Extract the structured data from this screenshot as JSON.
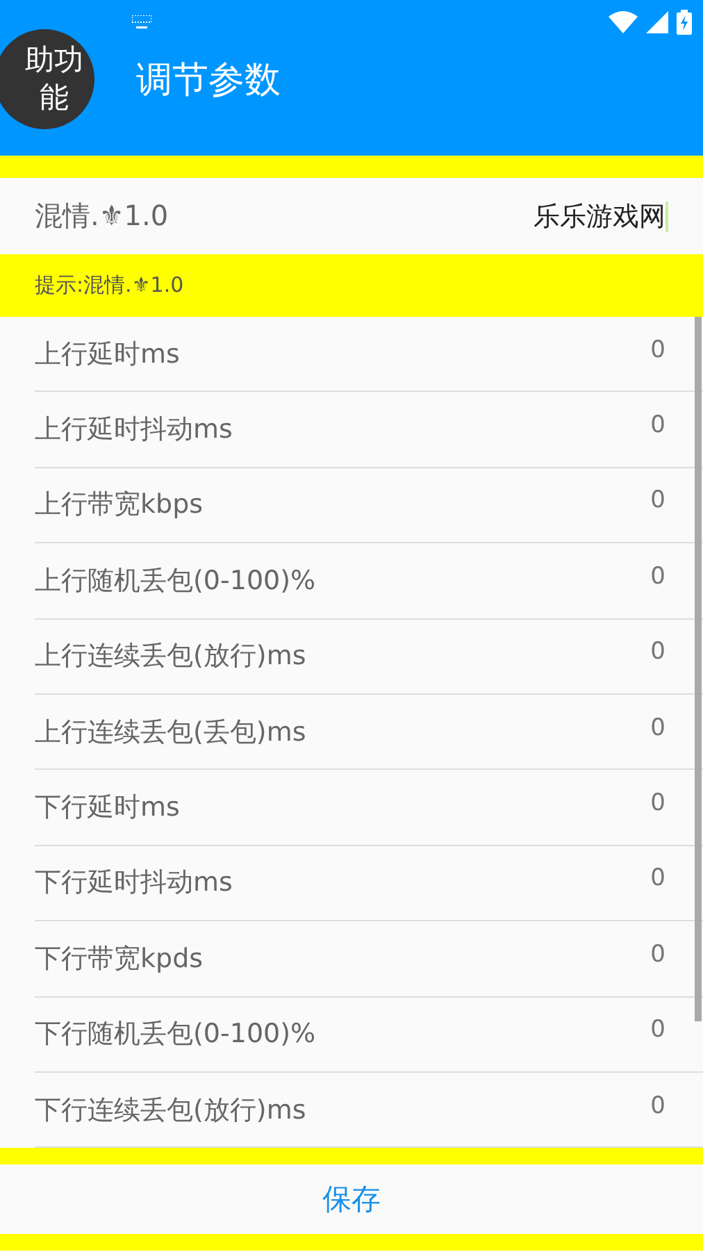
{
  "status_bar": {
    "keyboard_indicator": true
  },
  "header": {
    "float_button": [
      "助功",
      "能"
    ],
    "title": "调节参数"
  },
  "name_field": {
    "label": "混情.⚜1.0",
    "value": "乐乐游戏网"
  },
  "hint": "提示:混情.⚜1.0",
  "params": [
    {
      "label": "上行延时ms",
      "value": "0"
    },
    {
      "label": "上行延时抖动ms",
      "value": "0"
    },
    {
      "label": "上行带宽kbps",
      "value": "0"
    },
    {
      "label": "上行随机丢包(0-100)%",
      "value": "0"
    },
    {
      "label": "上行连续丢包(放行)ms",
      "value": "0"
    },
    {
      "label": "上行连续丢包(丢包)ms",
      "value": "0"
    },
    {
      "label": "下行延时ms",
      "value": "0"
    },
    {
      "label": "下行延时抖动ms",
      "value": "0"
    },
    {
      "label": "下行带宽kpds",
      "value": "0"
    },
    {
      "label": "下行随机丢包(0-100)%",
      "value": "0"
    },
    {
      "label": "下行连续丢包(放行)ms",
      "value": "0"
    }
  ],
  "save_button": "保存"
}
